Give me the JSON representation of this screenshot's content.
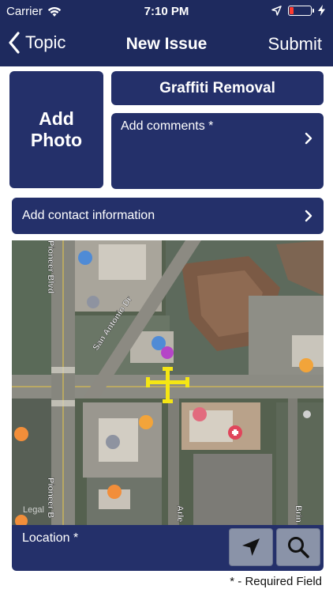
{
  "status_bar": {
    "carrier": "Carrier",
    "time": "7:10 PM",
    "battery_level": 0.2,
    "icons": [
      "wifi-icon",
      "location-arrow-icon",
      "battery-icon",
      "charging-bolt-icon"
    ]
  },
  "nav": {
    "back_label": "Topic",
    "title": "New Issue",
    "submit_label": "Submit"
  },
  "form": {
    "add_photo_label": "Add Photo",
    "topic_label": "Graffiti Removal",
    "comments_label": "Add comments *",
    "contact_label": "Add contact information",
    "location_label": "Location *"
  },
  "map": {
    "street_labels": [
      "San Antonio Dr",
      "Pioneer Blvd",
      "Pioneer B",
      "Arle",
      "Brin"
    ],
    "legal_label": "Legal"
  },
  "footer": {
    "required_note": "* - Required Field"
  },
  "colors": {
    "primary": "#1e2a5e",
    "button": "#24306a",
    "map_button": "#8a93a8",
    "pin": "#f5e614"
  }
}
